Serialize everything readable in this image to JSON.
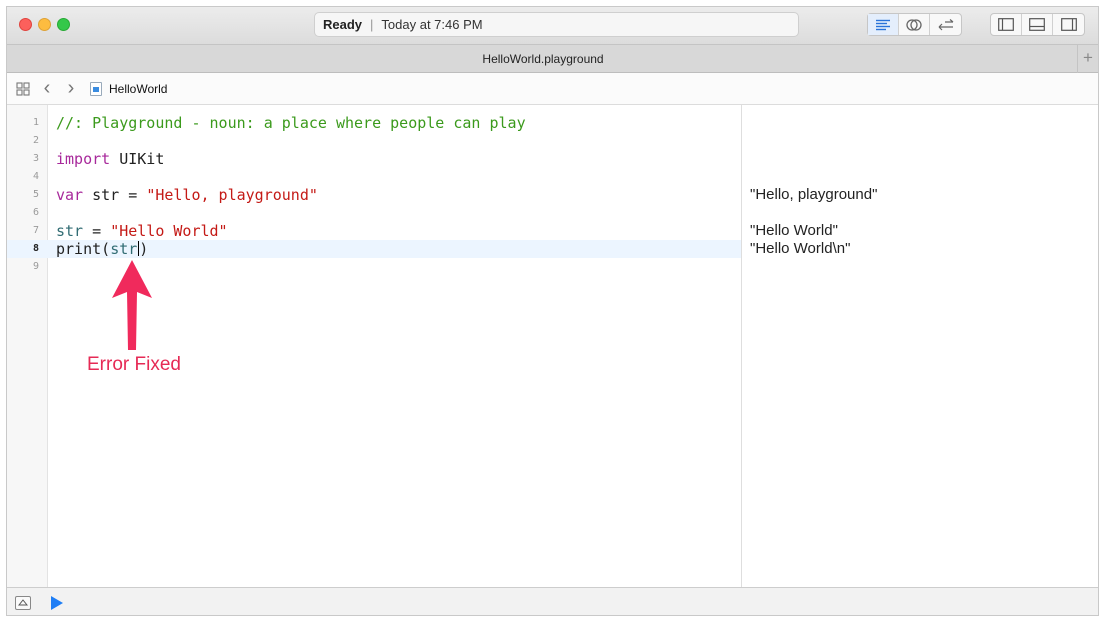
{
  "titlebar": {
    "status_ready": "Ready",
    "status_separator": "|",
    "status_time": "Today at 7:46 PM"
  },
  "tab": {
    "title": "HelloWorld.playground",
    "add_label": "+"
  },
  "jumpbar": {
    "back_label": "‹",
    "forward_label": "›",
    "crumb": "HelloWorld"
  },
  "editor": {
    "lines": [
      {
        "num": "1",
        "comment": "//: Playground - noun: a place where people can play"
      },
      {
        "num": "2"
      },
      {
        "num": "3",
        "kw": "import",
        "rest": " UIKit"
      },
      {
        "num": "4"
      },
      {
        "num": "5",
        "kw": "var",
        "rest": " str = ",
        "str": "\"Hello, playground\""
      },
      {
        "num": "6"
      },
      {
        "num": "7",
        "id": "str",
        "rest": " = ",
        "str": "\"Hello World\""
      },
      {
        "num": "8",
        "call": "print(",
        "arg1": "st",
        "arg2": "r",
        "close": ")"
      },
      {
        "num": "9"
      }
    ]
  },
  "results": {
    "line5": "\"Hello, playground\"",
    "line7": "\"Hello World\"",
    "line8": "\"Hello World\\n\""
  },
  "annotation": {
    "label": "Error Fixed",
    "color": "#e62a55"
  },
  "colors": {
    "comment": "#3b9a1c",
    "keyword": "#a8299b",
    "string": "#c41a16",
    "identifier": "#326d74",
    "play": "#1f7ef5"
  }
}
